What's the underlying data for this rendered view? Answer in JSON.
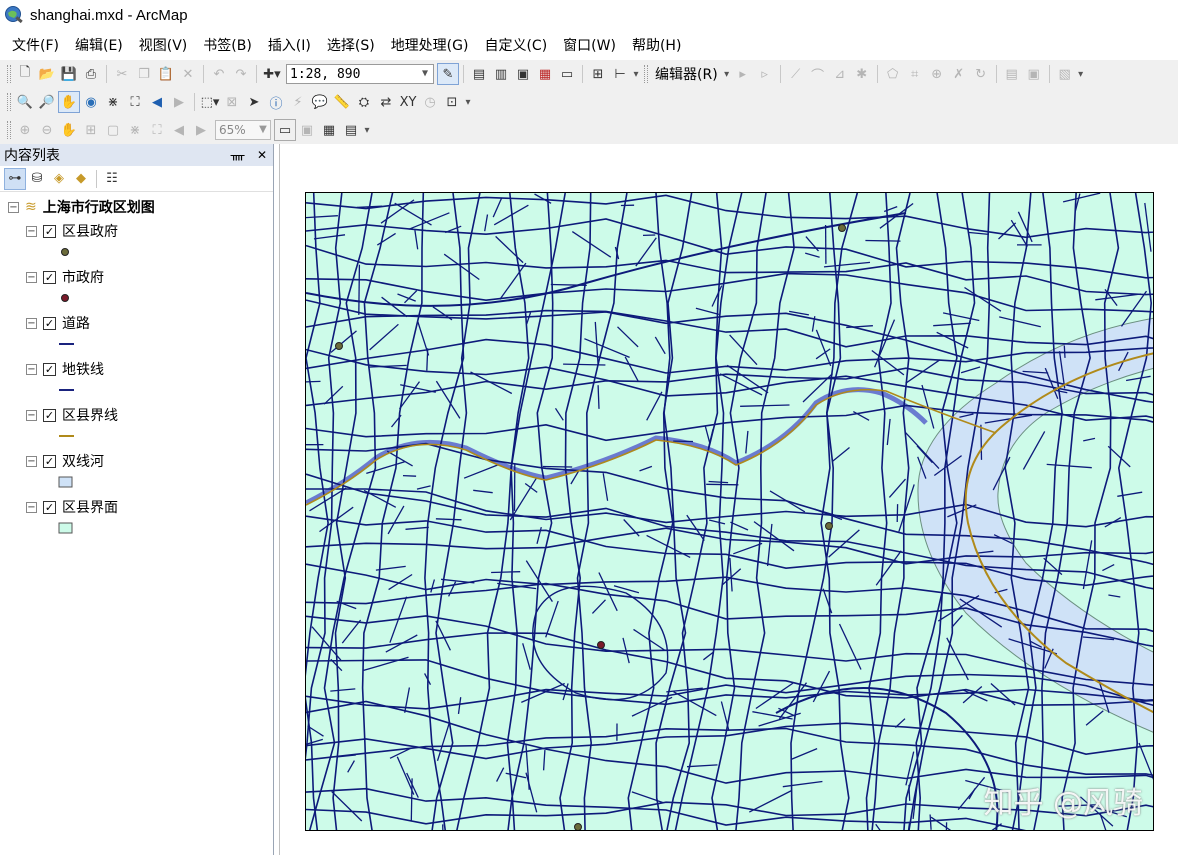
{
  "window": {
    "title": "shanghai.mxd - ArcMap"
  },
  "menu": [
    "文件(F)",
    "编辑(E)",
    "视图(V)",
    "书签(B)",
    "插入(I)",
    "选择(S)",
    "地理处理(G)",
    "自定义(C)",
    "窗口(W)",
    "帮助(H)"
  ],
  "toolbar": {
    "scale": "1:28, 890",
    "editor_label": "编辑器(R)",
    "zoom_percent": "65%"
  },
  "toc": {
    "title": "内容列表",
    "group_name": "上海市行政区划图",
    "layers": [
      {
        "name": "区县政府",
        "checked": true,
        "symbol": "point",
        "color": "#6b6b3a"
      },
      {
        "name": "市政府",
        "checked": true,
        "symbol": "point",
        "color": "#7a1a2a"
      },
      {
        "name": "道路",
        "checked": true,
        "symbol": "line",
        "color": "#1a237e"
      },
      {
        "name": "地铁线",
        "checked": true,
        "symbol": "line",
        "color": "#1a237e"
      },
      {
        "name": "区县界线",
        "checked": true,
        "symbol": "line",
        "color": "#b08a1a"
      },
      {
        "name": "双线河",
        "checked": true,
        "symbol": "fill",
        "color": "#cfe2f7"
      },
      {
        "name": "区县界面",
        "checked": true,
        "symbol": "fill",
        "color": "#cdfbe9"
      }
    ]
  },
  "map": {
    "land_color": "#cdfbe9",
    "river_color": "#cfe2f7",
    "road_color": "#0d1a7a",
    "boundary_color": "#b08a1a",
    "watermark": "知乎 @风骑"
  }
}
